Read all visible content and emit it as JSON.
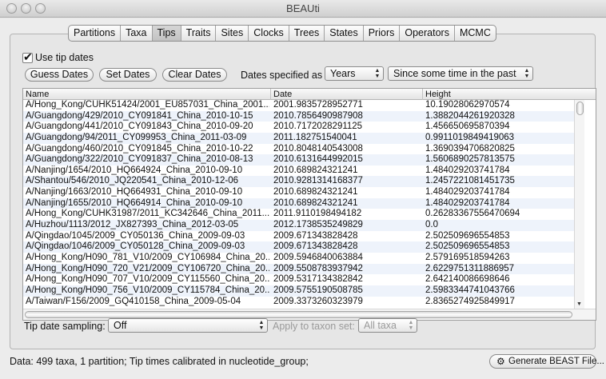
{
  "window": {
    "title": "BEAUti"
  },
  "tabs": [
    {
      "label": "Partitions",
      "active": false
    },
    {
      "label": "Taxa",
      "active": false
    },
    {
      "label": "Tips",
      "active": true
    },
    {
      "label": "Traits",
      "active": false
    },
    {
      "label": "Sites",
      "active": false
    },
    {
      "label": "Clocks",
      "active": false
    },
    {
      "label": "Trees",
      "active": false
    },
    {
      "label": "States",
      "active": false
    },
    {
      "label": "Priors",
      "active": false
    },
    {
      "label": "Operators",
      "active": false
    },
    {
      "label": "MCMC",
      "active": false
    }
  ],
  "tip_dates": {
    "use_tip_dates_label": "Use tip dates",
    "use_tip_dates_checked": true,
    "guess_dates_label": "Guess Dates",
    "set_dates_label": "Set Dates",
    "clear_dates_label": "Clear Dates",
    "dates_specified_label": "Dates specified as",
    "units_value": "Years",
    "direction_value": "Since some time in the past"
  },
  "table": {
    "columns": [
      "Name",
      "Date",
      "Height"
    ],
    "rows": [
      [
        "A/Hong_Kong/CUHK51424/2001_EU857031_China_2001...",
        "2001.9835728952771",
        "10.19028062970574"
      ],
      [
        "A/Guangdong/429/2010_CY091841_China_2010-10-15",
        "2010.7856490987908",
        "1.3882044261920328"
      ],
      [
        "A/Guangdong/441/2010_CY091843_China_2010-09-20",
        "2010.7172028291125",
        "1.456650695870394"
      ],
      [
        "A/Guangdong/94/2011_CY099953_China_2011-03-09",
        "2011.182751540041",
        "0.9911019849419063"
      ],
      [
        "A/Guangdong/460/2010_CY091845_China_2010-10-22",
        "2010.8048140543008",
        "1.3690394706820825"
      ],
      [
        "A/Guangdong/322/2010_CY091837_China_2010-08-13",
        "2010.6131644992015",
        "1.5606890257813575"
      ],
      [
        "A/Nanjing/1654/2010_HQ664924_China_2010-09-10",
        "2010.689824321241",
        "1.484029203741784"
      ],
      [
        "A/Shantou/546/2010_JQ220541_China_2010-12-06",
        "2010.9281314168377",
        "1.2457221081451735"
      ],
      [
        "A/Nanjing/1663/2010_HQ664931_China_2010-09-10",
        "2010.689824321241",
        "1.484029203741784"
      ],
      [
        "A/Nanjing/1655/2010_HQ664914_China_2010-09-10",
        "2010.689824321241",
        "1.484029203741784"
      ],
      [
        "A/Hong_Kong/CUHK31987/2011_KC342646_China_2011...",
        "2011.9110198494182",
        "0.26283367556470694"
      ],
      [
        "A/Huzhou/1113/2012_JX827393_China_2012-03-05",
        "2012.1738535249829",
        "0.0"
      ],
      [
        "A/Qingdao/1045/2009_CY050136_China_2009-09-03",
        "2009.671343828428",
        "2.502509696554853"
      ],
      [
        "A/Qingdao/1046/2009_CY050128_China_2009-09-03",
        "2009.671343828428",
        "2.502509696554853"
      ],
      [
        "A/Hong_Kong/H090_781_V10/2009_CY106984_China_20...",
        "2009.5946840063884",
        "2.579169518594263"
      ],
      [
        "A/Hong_Kong/H090_720_V21/2009_CY106720_China_20...",
        "2009.5508783937942",
        "2.6229751311886957"
      ],
      [
        "A/Hong_Kong/H090_707_V10/2009_CY115560_China_20...",
        "2009.5317134382842",
        "2.642140086698646"
      ],
      [
        "A/Hong_Kong/H090_756_V10/2009_CY115784_China_20...",
        "2009.5755190508785",
        "2.5983344741043766"
      ],
      [
        "A/Taiwan/F156/2009_GQ410158_China_2009-05-04",
        "2009.3373260323979",
        "2.8365274925849917"
      ]
    ]
  },
  "tip_date_sampling": {
    "label": "Tip date sampling:",
    "value": "Off",
    "apply_label": "Apply to taxon set:",
    "apply_value": "All taxa"
  },
  "status": {
    "text": "Data: 499 taxa, 1 partition; Tip times calibrated in nucleotide_group;",
    "generate_label": "Generate BEAST File..."
  }
}
